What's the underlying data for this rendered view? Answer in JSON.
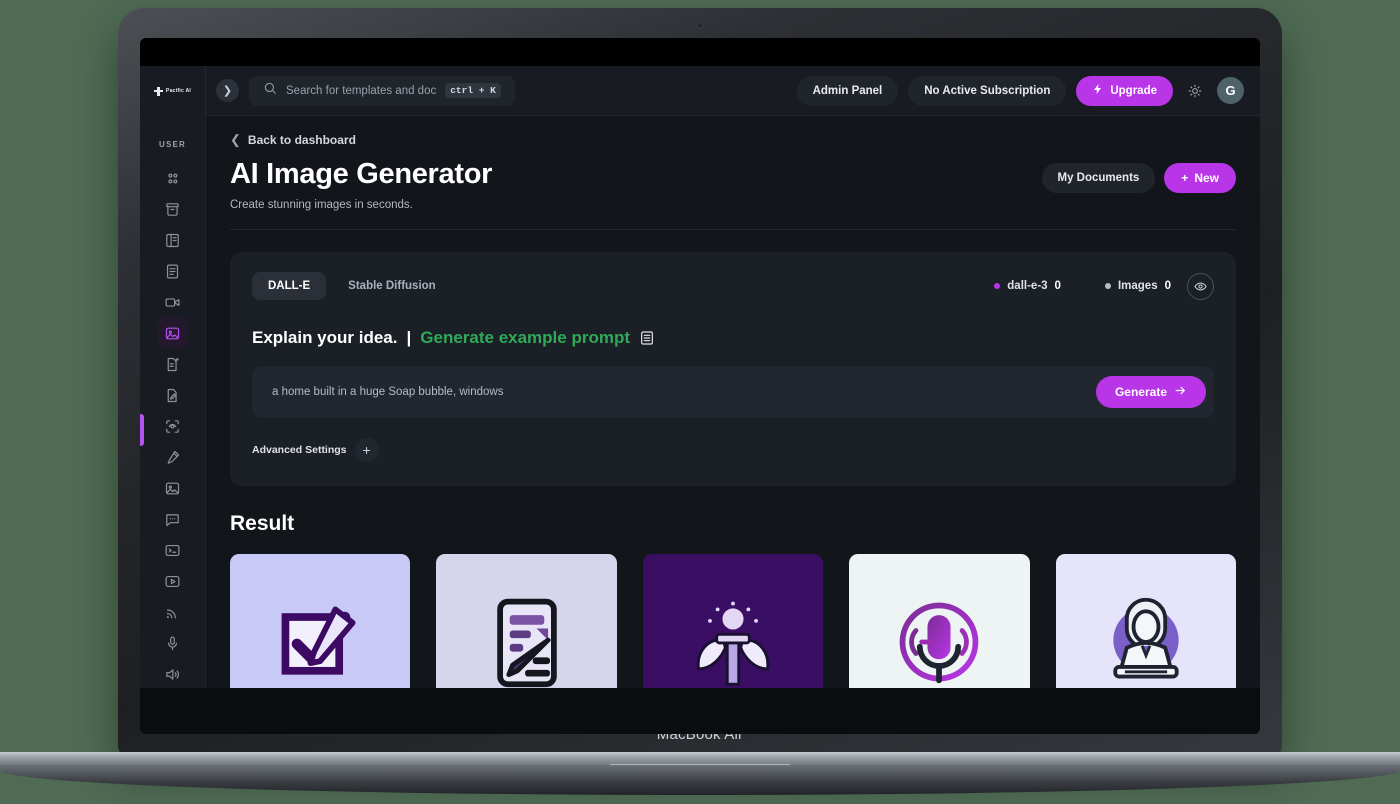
{
  "device": {
    "label": "MacBook Air"
  },
  "colors": {
    "desktop_bg": "#4f6b54",
    "app_bg": "#12151a",
    "panel_bg": "#181b21",
    "card_bg": "#1b1f26",
    "accent_purple": "#b935e8",
    "accent_green": "#2eaa58",
    "active_icon": "#b552f0"
  },
  "sidebar": {
    "brand": "Pacific AI",
    "section_label": "USER",
    "items": [
      {
        "icon": "grid-dots-icon",
        "name": "sidebar-item-dashboard",
        "active": false
      },
      {
        "icon": "archive-box-icon",
        "name": "sidebar-item-archive",
        "active": false
      },
      {
        "icon": "book-panel-icon",
        "name": "sidebar-item-templates",
        "active": false
      },
      {
        "icon": "document-lines-icon",
        "name": "sidebar-item-documents",
        "active": false
      },
      {
        "icon": "video-camera-icon",
        "name": "sidebar-item-video",
        "active": false
      },
      {
        "icon": "image-icon",
        "name": "sidebar-item-ai-image-generator",
        "active": true
      },
      {
        "icon": "document-sparkle-icon",
        "name": "sidebar-item-ai-writer",
        "active": false
      },
      {
        "icon": "file-pencil-icon",
        "name": "sidebar-item-file-edit",
        "active": false
      },
      {
        "icon": "scan-eye-icon",
        "name": "sidebar-item-vision",
        "active": false
      },
      {
        "icon": "pen-tool-icon",
        "name": "sidebar-item-pen-tool",
        "active": false
      },
      {
        "icon": "photo-icon",
        "name": "sidebar-item-photo-studio",
        "active": false
      },
      {
        "icon": "chat-bubble-icon",
        "name": "sidebar-item-chat",
        "active": false
      },
      {
        "icon": "terminal-icon",
        "name": "sidebar-item-code",
        "active": false
      },
      {
        "icon": "play-box-icon",
        "name": "sidebar-item-media",
        "active": false
      },
      {
        "icon": "rss-icon",
        "name": "sidebar-item-feed",
        "active": false
      },
      {
        "icon": "microphone-icon",
        "name": "sidebar-item-speech-to-text",
        "active": false
      },
      {
        "icon": "speaker-icon",
        "name": "sidebar-item-text-to-speech",
        "active": false
      },
      {
        "icon": "user-plus-icon",
        "name": "sidebar-item-affiliates",
        "active": false
      },
      {
        "icon": "book-open-icon",
        "name": "sidebar-item-docs",
        "active": false
      }
    ]
  },
  "topbar": {
    "collapse_icon": "chevron-right-icon",
    "search": {
      "icon": "search-icon",
      "placeholder": "Search for templates and doc",
      "shortcut": "ctrl + K"
    },
    "admin_label": "Admin Panel",
    "subscription_label": "No Active Subscription",
    "upgrade_label": "Upgrade",
    "upgrade_icon": "bolt-icon",
    "theme_icon": "sun-icon",
    "avatar_initial": "G"
  },
  "page": {
    "back_label": "Back to dashboard",
    "title": "AI Image Generator",
    "subtitle": "Create stunning images in seconds.",
    "my_documents_label": "My Documents",
    "new_label": "New"
  },
  "generator": {
    "model_tabs": [
      {
        "label": "DALL-E",
        "active": true
      },
      {
        "label": "Stable Diffusion",
        "active": false
      }
    ],
    "counters": [
      {
        "name": "dall-e-3",
        "value": "0",
        "color": "#b935e8"
      },
      {
        "name": "Images",
        "value": "0",
        "color": "#b9bec8"
      }
    ],
    "preview_icon": "eye-icon",
    "idea_label": "Explain your idea.",
    "idea_separator": "|",
    "idea_link": "Generate example prompt",
    "idea_doc_icon": "list-document-icon",
    "prompt_value": "a home built in a huge Soap bubble, windows",
    "generate_label": "Generate",
    "generate_icon": "arrow-right-icon",
    "advanced_label": "Advanced Settings",
    "advanced_icon": "plus-icon"
  },
  "result": {
    "title": "Result",
    "items": [
      {
        "name": "result-thumb-checklist",
        "bg": "#c9c9f7",
        "icon": "checkbox-pencil-icon"
      },
      {
        "name": "result-thumb-form-edit",
        "bg": "#d5d5ec",
        "icon": "document-pencil-icon"
      },
      {
        "name": "result-thumb-angel-sword",
        "bg": "#3a0e63",
        "icon": "winged-sword-icon"
      },
      {
        "name": "result-thumb-microphone",
        "bg": "#edf4f3",
        "icon": "podcast-mic-icon"
      },
      {
        "name": "result-thumb-presenter",
        "bg": "#e6e4fb",
        "icon": "person-laptop-icon"
      }
    ]
  }
}
